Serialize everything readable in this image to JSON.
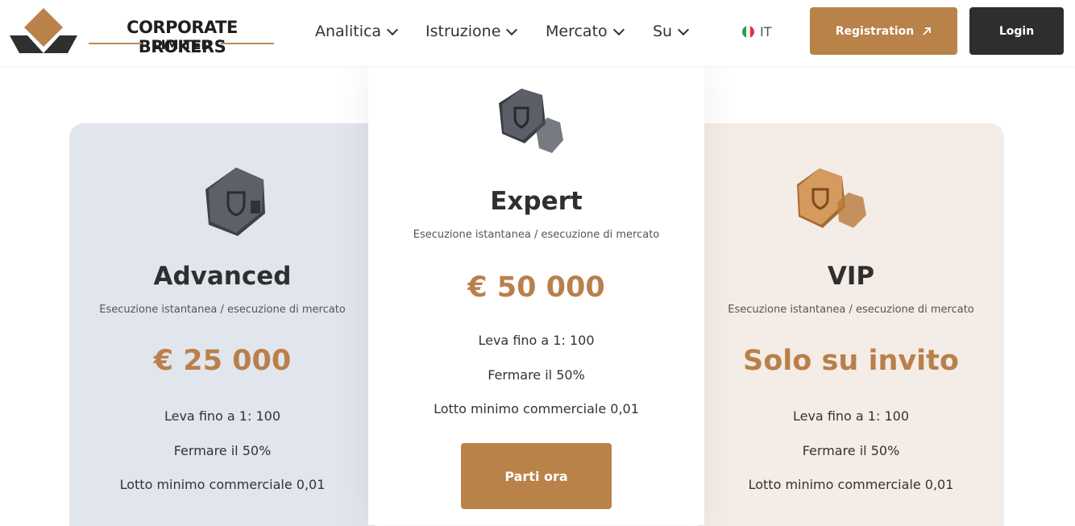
{
  "brand": {
    "name_line1": "CORPORATE BROKERS",
    "name_line2": "LIMITED"
  },
  "nav": [
    {
      "label": "Analitica"
    },
    {
      "label": "Istruzione"
    },
    {
      "label": "Mercato"
    },
    {
      "label": "Su"
    }
  ],
  "language": {
    "code": "IT"
  },
  "buttons": {
    "register": "Registration",
    "login": "Login",
    "start": "Parti ora"
  },
  "plans": [
    {
      "name": "Advanced",
      "subtitle": "Esecuzione istantanea / esecuzione di mercato",
      "price": "€ 25 000",
      "features": [
        "Leva fino a 1: 100",
        "Fermare il 50%",
        "Lotto minimo commerciale 0,01"
      ]
    },
    {
      "name": "Expert",
      "subtitle": "Esecuzione istantanea / esecuzione di mercato",
      "price": "€ 50 000",
      "features": [
        "Leva fino a 1: 100",
        "Fermare il 50%",
        "Lotto minimo commerciale 0,01"
      ]
    },
    {
      "name": "VIP",
      "subtitle": "Esecuzione istantanea / esecuzione di mercato",
      "price": "Solo su invito",
      "features": [
        "Leva fino a 1: 100",
        "Fermare il 50%",
        "Lotto minimo commerciale 0,01"
      ]
    }
  ],
  "colors": {
    "accent": "#b98249",
    "dark": "#2e2e2e",
    "card_left_bg": "#e1e6ec",
    "card_right_bg": "#f4ece6"
  }
}
